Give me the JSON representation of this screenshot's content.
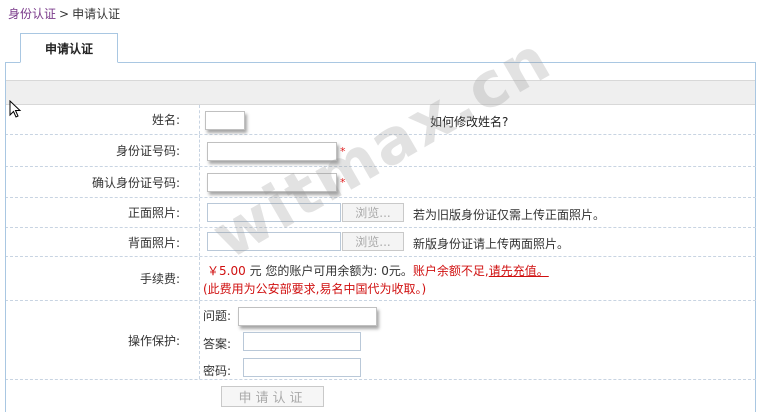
{
  "breadcrumb": {
    "link": "身份认证",
    "separator": ">",
    "current": "申请认证"
  },
  "tab": {
    "label": "申请认证"
  },
  "form": {
    "name": {
      "label": "姓名:",
      "help_link": "如何修改姓名?"
    },
    "id_number": {
      "label": "身份证号码:",
      "required_mark": "*"
    },
    "confirm_id": {
      "label": "确认身份证号码:",
      "required_mark": "*"
    },
    "front_photo": {
      "label": "正面照片:",
      "browse": "浏览...",
      "hint": "若为旧版身份证仅需上传正面照片。"
    },
    "back_photo": {
      "label": "背面照片:",
      "browse": "浏览...",
      "hint": "新版身份证请上传两面照片。"
    },
    "fee": {
      "label": "手续费:",
      "amount": "￥5.00",
      "unit": "元",
      "balance_text": "您的账户可用余额为:",
      "balance_value": "0元。",
      "insufficient": "账户余额不足,",
      "recharge_link": "请先充值。",
      "note": "(此费用为公安部要求,易名中国代为收取。)"
    },
    "protection": {
      "label": "操作保护:",
      "question_label": "问题:",
      "answer_label": "答案:",
      "password_label": "密码:"
    },
    "submit": "申请认证"
  },
  "watermark": "witmax.cn"
}
